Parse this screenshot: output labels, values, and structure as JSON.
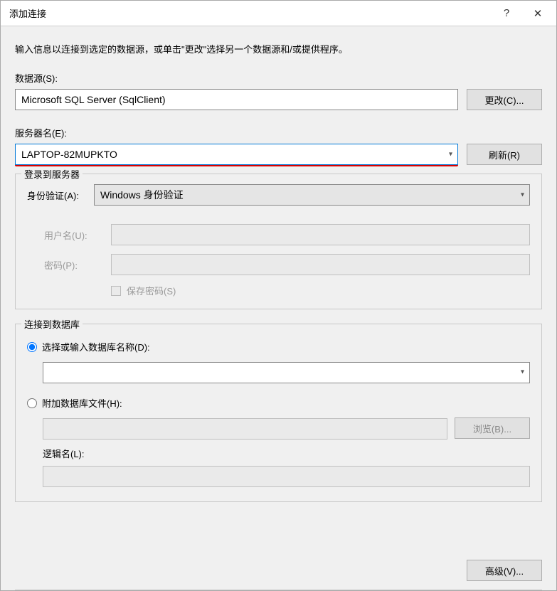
{
  "titlebar": {
    "title": "添加连接",
    "help_icon": "?",
    "close_icon": "✕"
  },
  "instruction": "输入信息以连接到选定的数据源，或单击\"更改\"选择另一个数据源和/或提供程序。",
  "datasource": {
    "label": "数据源(S):",
    "value": "Microsoft SQL Server (SqlClient)",
    "change_btn": "更改(C)..."
  },
  "server": {
    "label": "服务器名(E):",
    "value": "LAPTOP-82MUPKTO",
    "refresh_btn": "刷新(R)"
  },
  "login_group": {
    "legend": "登录到服务器",
    "auth_label": "身份验证(A):",
    "auth_value": "Windows 身份验证",
    "username_label": "用户名(U):",
    "username_value": "",
    "password_label": "密码(P):",
    "password_value": "",
    "save_pwd_label": "保存密码(S)"
  },
  "db_group": {
    "legend": "连接到数据库",
    "opt_select_label": "选择或输入数据库名称(D):",
    "select_value": "",
    "opt_attach_label": "附加数据库文件(H):",
    "attach_value": "",
    "browse_btn": "浏览(B)...",
    "logical_label": "逻辑名(L):",
    "logical_value": ""
  },
  "advanced_btn": "高级(V)..."
}
